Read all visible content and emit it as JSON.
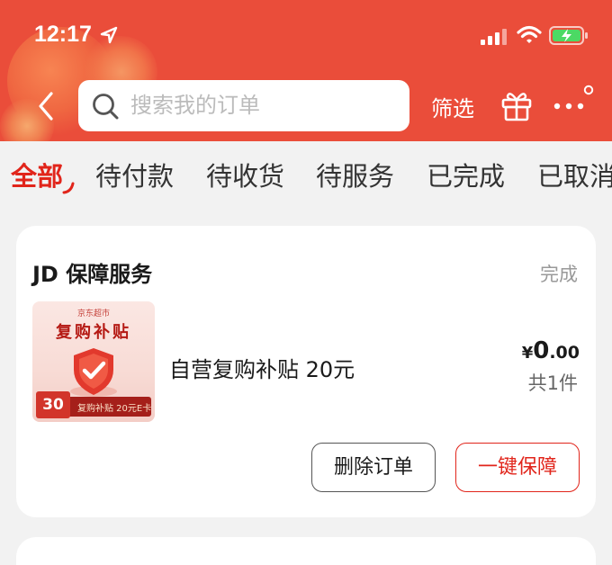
{
  "status_bar": {
    "time": "12:17",
    "icons": [
      "location-arrow-icon",
      "signal-icon",
      "wifi-icon",
      "battery-charging-icon"
    ]
  },
  "header": {
    "search_placeholder": "搜索我的订单",
    "filter_label": "筛选",
    "icons": [
      "back-arrow-icon",
      "search-icon",
      "gift-icon",
      "more-icon"
    ]
  },
  "tabs": [
    {
      "label": "全部",
      "active": true
    },
    {
      "label": "待付款",
      "active": false
    },
    {
      "label": "待收货",
      "active": false
    },
    {
      "label": "待服务",
      "active": false
    },
    {
      "label": "已完成",
      "active": false
    },
    {
      "label": "已取消",
      "active": false
    }
  ],
  "order": {
    "shop_name": "JD 保障服务",
    "status": "完成",
    "thumbnail": {
      "brand": "京东超市",
      "title": "复购补贴",
      "badge_number": "30",
      "bar_text": "复购补贴 20元E卡"
    },
    "item_name": "自营复购补贴 20元",
    "price_symbol": "¥",
    "price_int": "0",
    "price_dec": ".00",
    "quantity": "共1件",
    "buttons": {
      "delete": "删除订单",
      "protect": "一键保障"
    }
  },
  "colors": {
    "header_bg": "#ea4d3a",
    "accent": "#e1251b",
    "page_bg": "#f2f2f2"
  }
}
